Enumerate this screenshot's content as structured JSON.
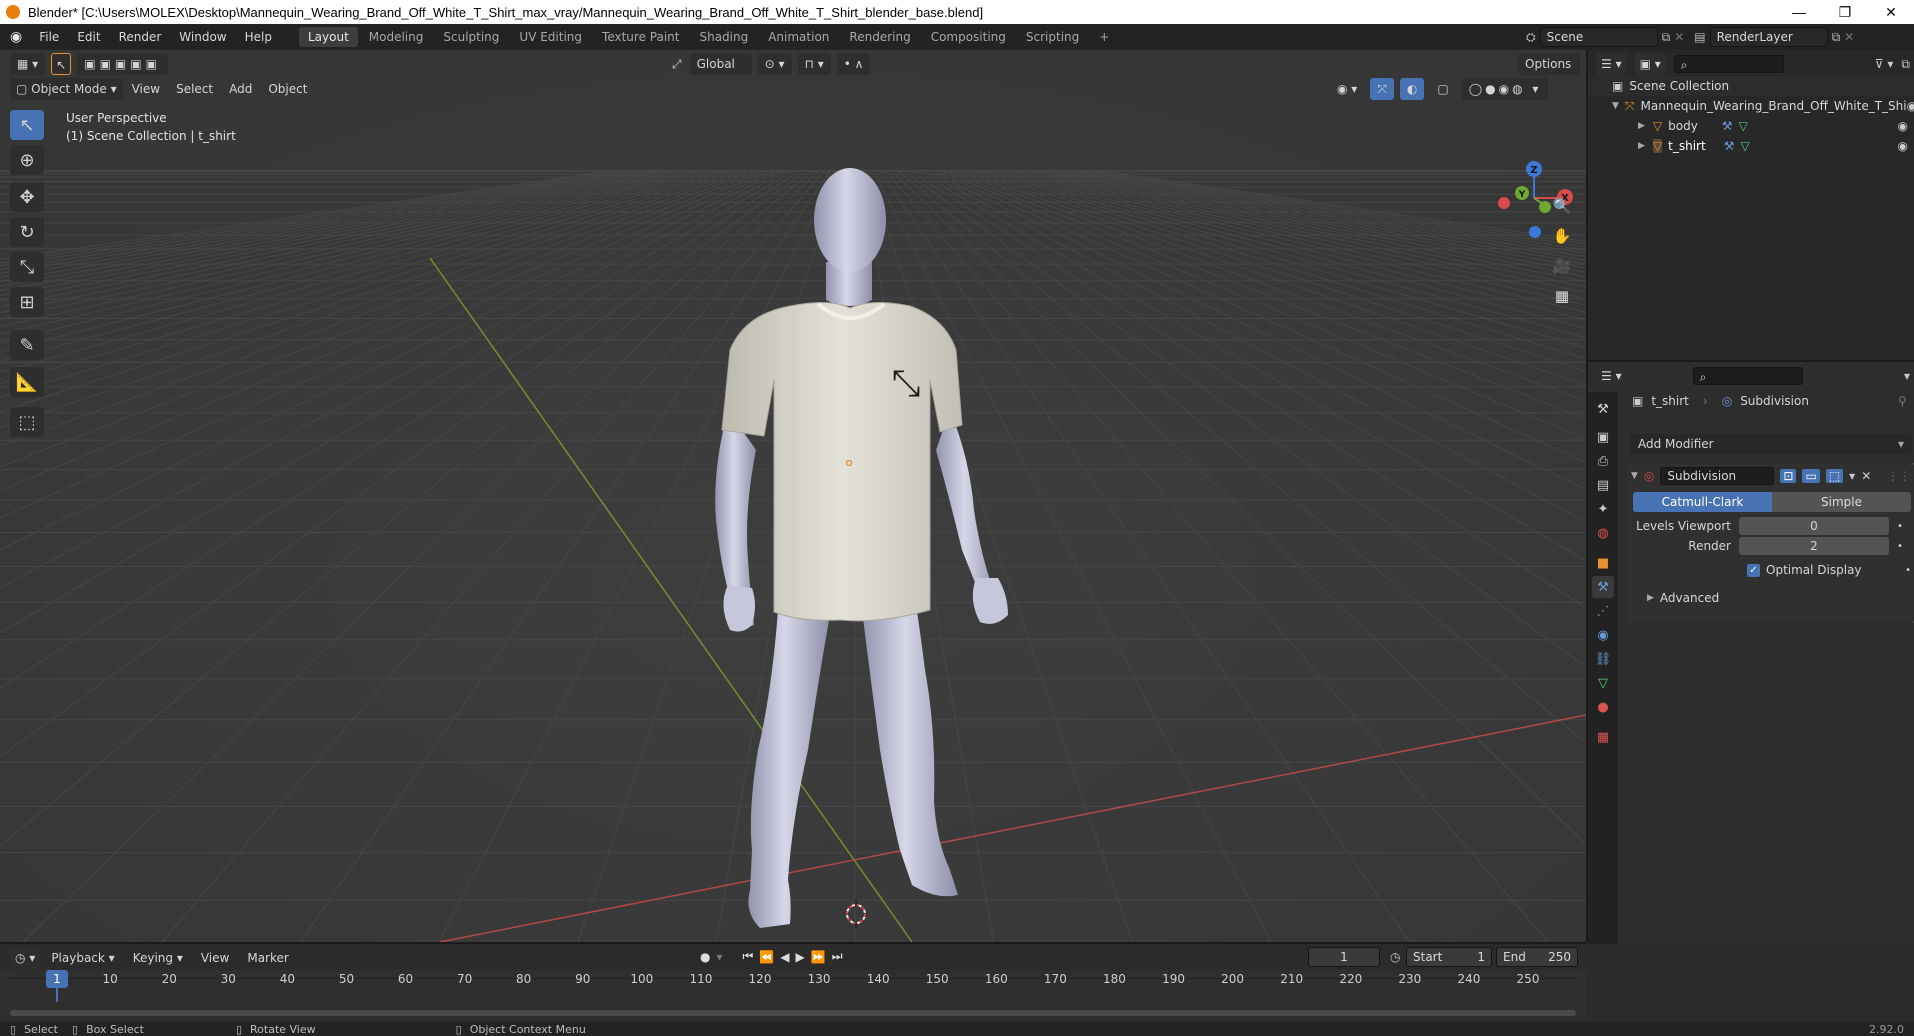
{
  "window": {
    "title": "Blender* [C:\\Users\\MOLEX\\Desktop\\Mannequin_Wearing_Brand_Off_White_T_Shirt_max_vray/Mannequin_Wearing_Brand_Off_White_T_Shirt_blender_base.blend]",
    "minimize": "—",
    "maximize": "❐",
    "close": "✕"
  },
  "menus": [
    "File",
    "Edit",
    "Render",
    "Window",
    "Help"
  ],
  "workspaces": [
    "Layout",
    "Modeling",
    "Sculpting",
    "UV Editing",
    "Texture Paint",
    "Shading",
    "Animation",
    "Rendering",
    "Compositing",
    "Scripting",
    "+"
  ],
  "active_workspace": "Layout",
  "scene": {
    "name": "Scene",
    "render_layer": "RenderLayer"
  },
  "viewport": {
    "mode": "Object Mode",
    "menus": [
      "View",
      "Select",
      "Add",
      "Object"
    ],
    "transform_orientation": "Global",
    "options_label": "Options",
    "overlay_line1": "User Perspective",
    "overlay_line2": "(1) Scene Collection | t_shirt",
    "gizmo_axes": {
      "z": "Z",
      "y": "Y",
      "x": "X"
    },
    "tools": [
      "select-box",
      "cursor",
      "move",
      "rotate",
      "scale",
      "transform",
      "annotate",
      "measure",
      "add-cube"
    ],
    "shirt_logo": "⤡",
    "colors": {
      "bg": "#393939",
      "grid": "#4a4a4a",
      "x_axis": "#b84b4b",
      "y_axis": "#6e8f33",
      "shirt": "#dedbd1",
      "mannequin": "#b8b9cf"
    }
  },
  "outliner": {
    "search_placeholder": "",
    "root": "Scene Collection",
    "items": [
      {
        "name": "Mannequin_Wearing_Brand_Off_White_T_Shi",
        "indent": 1
      },
      {
        "name": "body",
        "indent": 2
      },
      {
        "name": "t_shirt",
        "indent": 2
      }
    ]
  },
  "properties": {
    "object_name": "t_shirt",
    "modifier_crumb": "Subdivision",
    "add_modifier": "Add Modifier",
    "modifier": {
      "name": "Subdivision",
      "algorithms": [
        "Catmull-Clark",
        "Simple"
      ],
      "active_algorithm": "Catmull-Clark",
      "levels_viewport_label": "Levels Viewport",
      "levels_viewport": "0",
      "render_label": "Render",
      "render": "2",
      "optimal_display_label": "Optimal Display",
      "optimal_display": true,
      "advanced_label": "Advanced"
    },
    "tab_icons": [
      "tool",
      "render",
      "output",
      "view-layer",
      "scene",
      "world",
      "object",
      "modifier",
      "particles",
      "physics",
      "constraints",
      "data",
      "material",
      "texture"
    ]
  },
  "timeline": {
    "menus": [
      "Playback",
      "Keying",
      "View",
      "Marker"
    ],
    "current_frame": "1",
    "start_label": "Start",
    "start": "1",
    "end_label": "End",
    "end": "250",
    "ticks": [
      "1",
      "10",
      "20",
      "30",
      "40",
      "50",
      "60",
      "70",
      "80",
      "90",
      "100",
      "110",
      "120",
      "130",
      "140",
      "150",
      "160",
      "170",
      "180",
      "190",
      "200",
      "210",
      "220",
      "230",
      "240",
      "250"
    ]
  },
  "statusbar": {
    "select": "Select",
    "box_select": "Box Select",
    "rotate_view": "Rotate View",
    "context_menu": "Object Context Menu",
    "version": "2.92.0"
  }
}
